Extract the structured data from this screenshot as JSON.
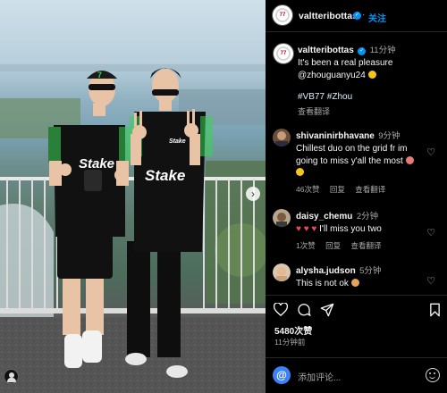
{
  "post": {
    "username": "valtteribottas",
    "follow_label": "关注",
    "caption_time": "11分钟",
    "caption_line1": "It's been a real pleasure",
    "caption_line2": "@zhouguanyu24",
    "hashtags": "#VB77 #Zhou",
    "translate_label": "查看翻译",
    "likes": "5480次赞",
    "posted_ago": "11分钟前",
    "add_comment_placeholder": "添加评论..."
  },
  "comments": [
    {
      "username": "shivaninirbhavane",
      "time": "9分钟",
      "text_line1": "Chillest duo on the grid fr im",
      "text_line2": "going to miss y'all the most",
      "likes": "46次赞",
      "reply": "回复",
      "translate": "查看翻译"
    },
    {
      "username": "daisy_chemu",
      "time": "2分钟",
      "text": "I'll miss you two",
      "likes": "1次赞",
      "reply": "回复",
      "translate": "查看翻译"
    },
    {
      "username": "alysha.judson",
      "time": "5分钟",
      "text": "This is not ok"
    }
  ],
  "colors": {
    "accent": "#0095f6",
    "kit_green": "#39d353",
    "like_red": "#ed4956"
  },
  "icons": {
    "photo_next": "chevron-right-icon",
    "like": "heart-icon",
    "comment": "comment-bubble-icon",
    "share": "paper-plane-icon",
    "save": "bookmark-icon"
  }
}
